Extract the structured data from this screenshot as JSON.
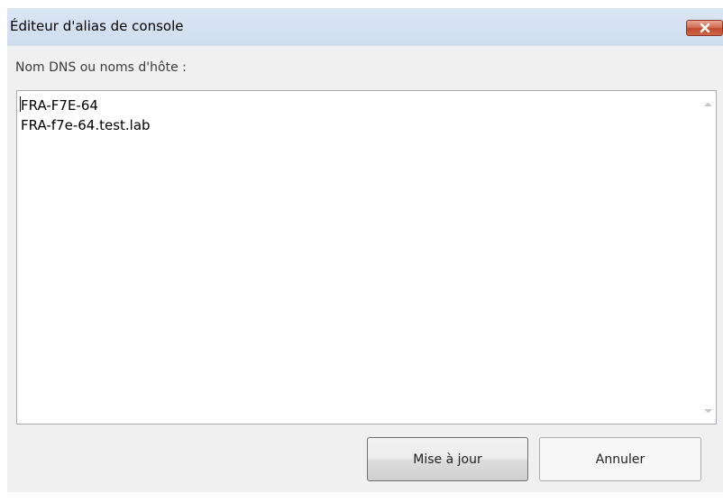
{
  "window": {
    "title": "Éditeur d'alias de console",
    "close_icon": "close-icon"
  },
  "prompt": {
    "label": "Nom DNS ou noms d'hôte :"
  },
  "hostnames": {
    "lines": [
      "FRA-F7E-64",
      "FRA-f7e-64.test.lab"
    ]
  },
  "scrollbar": {
    "up_icon": "scroll-up-arrow-icon",
    "down_icon": "scroll-down-arrow-icon"
  },
  "buttons": {
    "update_label": "Mise à jour",
    "cancel_label": "Annuler"
  },
  "colors": {
    "titlebar": "#cedcee",
    "close_button": "#c04a2c",
    "dialog_background": "#f0f0f0"
  }
}
